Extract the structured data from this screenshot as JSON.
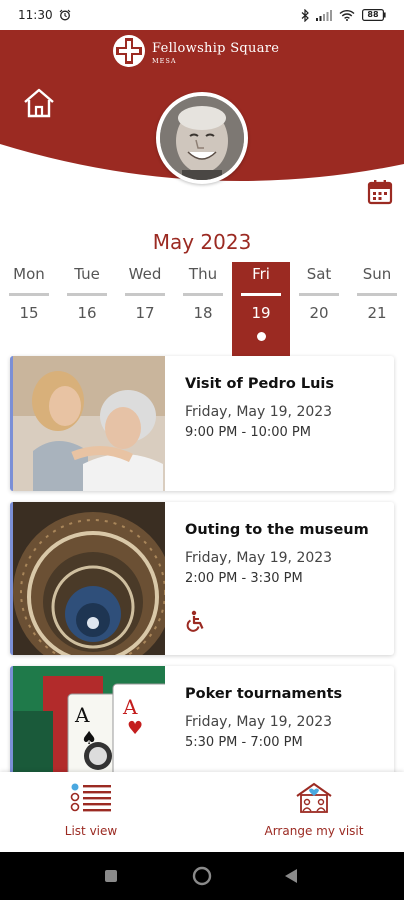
{
  "status_bar": {
    "time": "11:30",
    "battery": "88"
  },
  "header": {
    "brand_name": "Fellowship Square",
    "brand_sub": "MESA"
  },
  "calendar": {
    "month_label": "May 2023",
    "days": [
      {
        "name": "Mon",
        "num": "15"
      },
      {
        "name": "Tue",
        "num": "16"
      },
      {
        "name": "Wed",
        "num": "17"
      },
      {
        "name": "Thu",
        "num": "18"
      },
      {
        "name": "Fri",
        "num": "19"
      },
      {
        "name": "Sat",
        "num": "20"
      },
      {
        "name": "Sun",
        "num": "21"
      }
    ],
    "selected_day_name": "Fri"
  },
  "events": [
    {
      "title": "Visit of Pedro Luis",
      "date": "Friday, May 19, 2023",
      "time": "9:00 PM - 10:00 PM"
    },
    {
      "title": "Outing to the museum",
      "date": "Friday, May 19, 2023",
      "time": "2:00 PM - 3:30 PM",
      "icon": "wheelchair-accessible-icon"
    },
    {
      "title": "Poker tournaments",
      "date": "Friday, May 19, 2023",
      "time": "5:30 PM - 7:00 PM"
    }
  ],
  "bottom_nav": {
    "list_view_label": "List view",
    "arrange_visit_label": "Arrange my visit"
  },
  "colors": {
    "brand": "#9b2a22",
    "accent_blue": "#7b8fd6"
  }
}
